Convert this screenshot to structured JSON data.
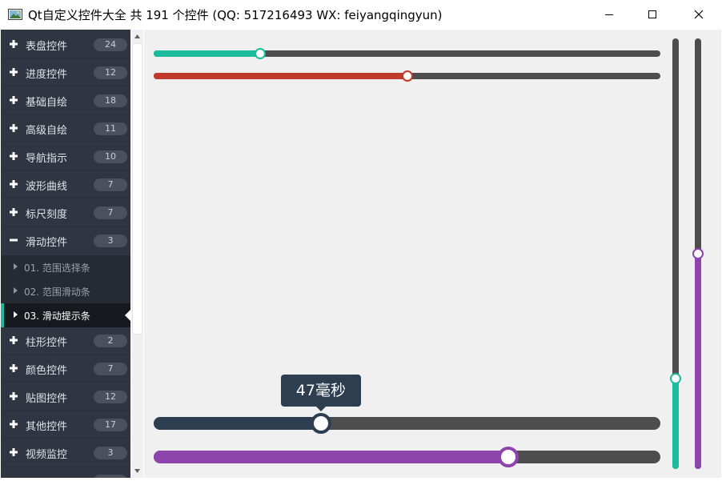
{
  "window": {
    "title": "Qt自定义控件大全 共 191 个控件 (QQ: 517216493 WX: feiyangqingyun)",
    "icon": "app-picture-icon",
    "controls": [
      "minimize-icon",
      "maximize-icon",
      "close-icon"
    ]
  },
  "sidebar": {
    "items": [
      {
        "label": "表盘控件",
        "count": "24",
        "icon": "plus-icon"
      },
      {
        "label": "进度控件",
        "count": "12",
        "icon": "plus-icon"
      },
      {
        "label": "基础自绘",
        "count": "18",
        "icon": "plus-icon"
      },
      {
        "label": "高级自绘",
        "count": "11",
        "icon": "plus-icon"
      },
      {
        "label": "导航指示",
        "count": "10",
        "icon": "plus-icon"
      },
      {
        "label": "波形曲线",
        "count": "7",
        "icon": "plus-icon"
      },
      {
        "label": "标尺刻度",
        "count": "7",
        "icon": "plus-icon"
      },
      {
        "label": "滑动控件",
        "count": "3",
        "icon": "minus-icon",
        "expanded": true
      },
      {
        "label": "柱形控件",
        "count": "2",
        "icon": "plus-icon"
      },
      {
        "label": "颜色控件",
        "count": "7",
        "icon": "plus-icon"
      },
      {
        "label": "贴图控件",
        "count": "12",
        "icon": "plus-icon"
      },
      {
        "label": "其他控件",
        "count": "17",
        "icon": "plus-icon"
      },
      {
        "label": "视频监控",
        "count": "3",
        "icon": "plus-icon"
      }
    ],
    "subitems": [
      {
        "label": "01. 范围选择条"
      },
      {
        "label": "02. 范围滑动条"
      },
      {
        "label": "03. 滑动提示条",
        "active": true
      }
    ],
    "accent": "#1abc9c"
  },
  "sliders": {
    "h1": {
      "value": 0.21,
      "color": "#1abc9c"
    },
    "h2": {
      "value": 0.5,
      "color": "#c0392b"
    },
    "h3": {
      "value": 0.33,
      "color": "#2c3e50",
      "tooltip": "47毫秒"
    },
    "h4": {
      "value": 0.7,
      "color": "#8e44ad"
    },
    "v1": {
      "value": 0.21,
      "color": "#1abc9c"
    },
    "v2": {
      "value": 0.5,
      "color": "#8e44ad"
    }
  }
}
